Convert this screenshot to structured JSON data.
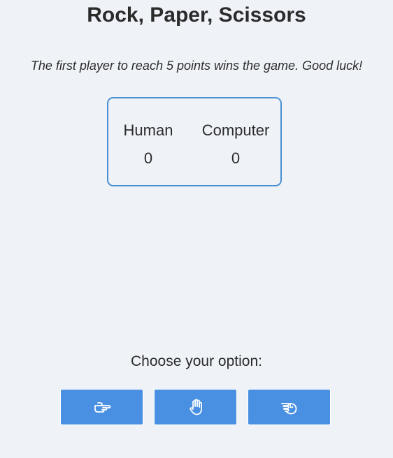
{
  "game": {
    "title": "Rock, Paper, Scissors",
    "tagline": "The first player to reach 5 points wins the game. Good luck!"
  },
  "scoreboard": {
    "players": [
      {
        "name": "Human",
        "score": "0"
      },
      {
        "name": "Computer",
        "score": "0"
      }
    ]
  },
  "controls": {
    "prompt": "Choose your option:",
    "options": [
      {
        "icon": "scissors-hand-icon"
      },
      {
        "icon": "paper-hand-icon"
      },
      {
        "icon": "rock-hand-icon"
      }
    ]
  },
  "colors": {
    "background": "#eff3f8",
    "accent": "#4a90e2",
    "scoreboard_border": "#4a90d2",
    "text": "#2b2b2b"
  }
}
